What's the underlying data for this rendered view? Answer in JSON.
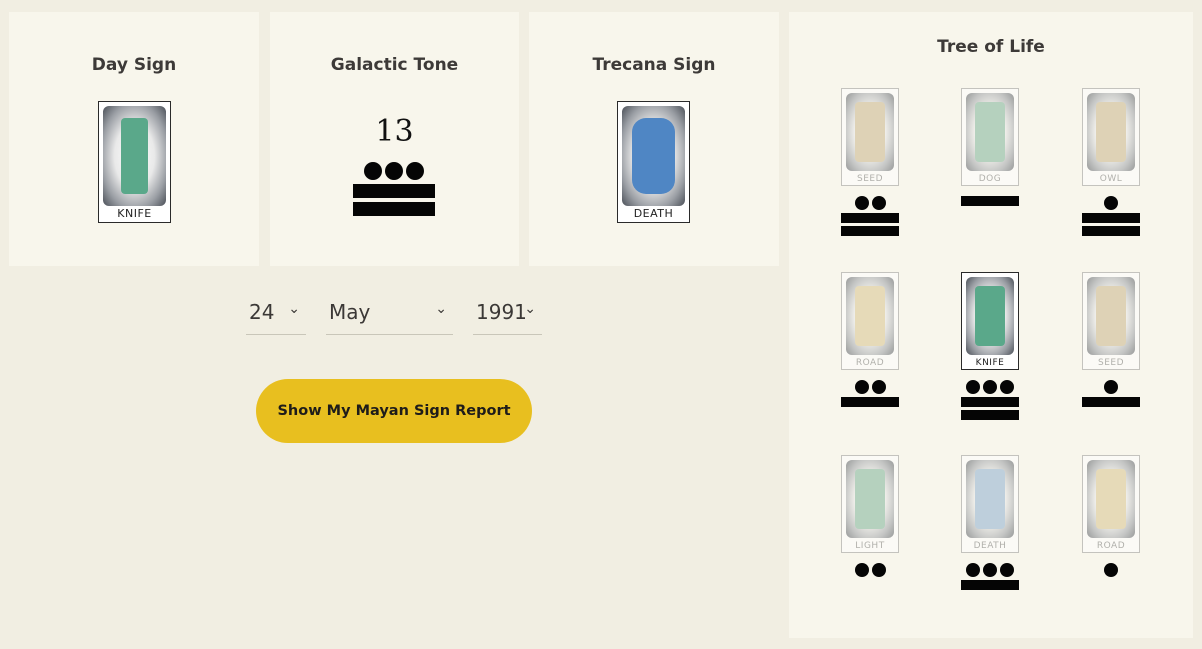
{
  "cards": {
    "day_sign": {
      "title": "Day Sign",
      "glyph_label": "KNIFE"
    },
    "galactic_tone": {
      "title": "Galactic Tone",
      "number": "13"
    },
    "trecana_sign": {
      "title": "Trecana Sign",
      "glyph_label": "DEATH"
    }
  },
  "birthdate": {
    "day": "24",
    "month": "May",
    "year": "1991"
  },
  "report_button": "Show My Mayan Sign Report",
  "tree_of_life": {
    "title": "Tree of Life",
    "cells": [
      {
        "label": "SEED",
        "tone": 12,
        "color": "#c9b68a"
      },
      {
        "label": "DOG",
        "tone": 5,
        "color": "#7fb49a"
      },
      {
        "label": "OWL",
        "tone": 11,
        "color": "#c9b68a"
      },
      {
        "label": "ROAD",
        "tone": 7,
        "color": "#d8c48e"
      },
      {
        "label": "KNIFE",
        "tone": 13,
        "color": "#5aa88a"
      },
      {
        "label": "SEED",
        "tone": 6,
        "color": "#c9b68a"
      },
      {
        "label": "LIGHT",
        "tone": 2,
        "color": "#7fb49a"
      },
      {
        "label": "DEATH",
        "tone": 8,
        "color": "#8fb0cf"
      },
      {
        "label": "ROAD",
        "tone": 1,
        "color": "#d8c48e"
      }
    ]
  },
  "icons": {
    "chevron": "chevron-down-icon"
  }
}
